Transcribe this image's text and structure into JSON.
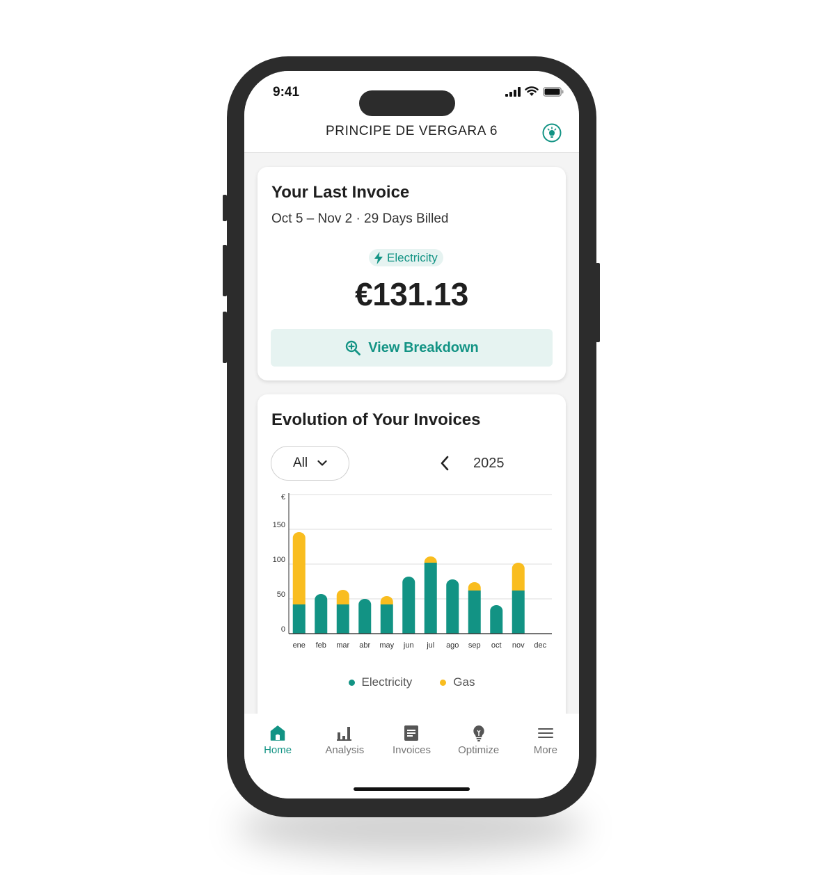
{
  "status_bar": {
    "time": "9:41"
  },
  "header": {
    "title": "PRINCIPE DE VERGARA 6"
  },
  "last_invoice": {
    "title": "Your Last Invoice",
    "period": "Oct 5 – Nov 2 · 29 Days Billed",
    "tag": "Electricity",
    "amount": "€131.13",
    "button_label": "View Breakdown"
  },
  "evolution": {
    "title": "Evolution of Your Invoices",
    "filter_value": "All",
    "year": "2025"
  },
  "colors": {
    "accent": "#129384",
    "electricity": "#129384",
    "gas": "#f9bd1f"
  },
  "chart_data": {
    "type": "bar",
    "stacked": true,
    "categories": [
      "ene",
      "feb",
      "mar",
      "abr",
      "may",
      "jun",
      "jul",
      "ago",
      "sep",
      "oct",
      "nov",
      "dec"
    ],
    "series": [
      {
        "name": "Electricity",
        "values": [
          42,
          57,
          42,
          50,
          42,
          82,
          102,
          78,
          62,
          41,
          62,
          0
        ]
      },
      {
        "name": "Gas",
        "values": [
          104,
          0,
          21,
          0,
          12,
          0,
          9,
          0,
          12,
          0,
          40,
          0
        ]
      }
    ],
    "ylabel": "€",
    "yticks": [
      "0",
      "50",
      "100",
      "150"
    ],
    "ylim": [
      0,
      200
    ],
    "grid": true,
    "legend": "bottom"
  },
  "tabs": [
    {
      "label": "Home",
      "icon": "home-icon",
      "active": true
    },
    {
      "label": "Analysis",
      "icon": "bar-chart-icon",
      "active": false
    },
    {
      "label": "Invoices",
      "icon": "document-icon",
      "active": false
    },
    {
      "label": "Optimize",
      "icon": "lightbulb-icon",
      "active": false
    },
    {
      "label": "More",
      "icon": "menu-icon",
      "active": false
    }
  ]
}
